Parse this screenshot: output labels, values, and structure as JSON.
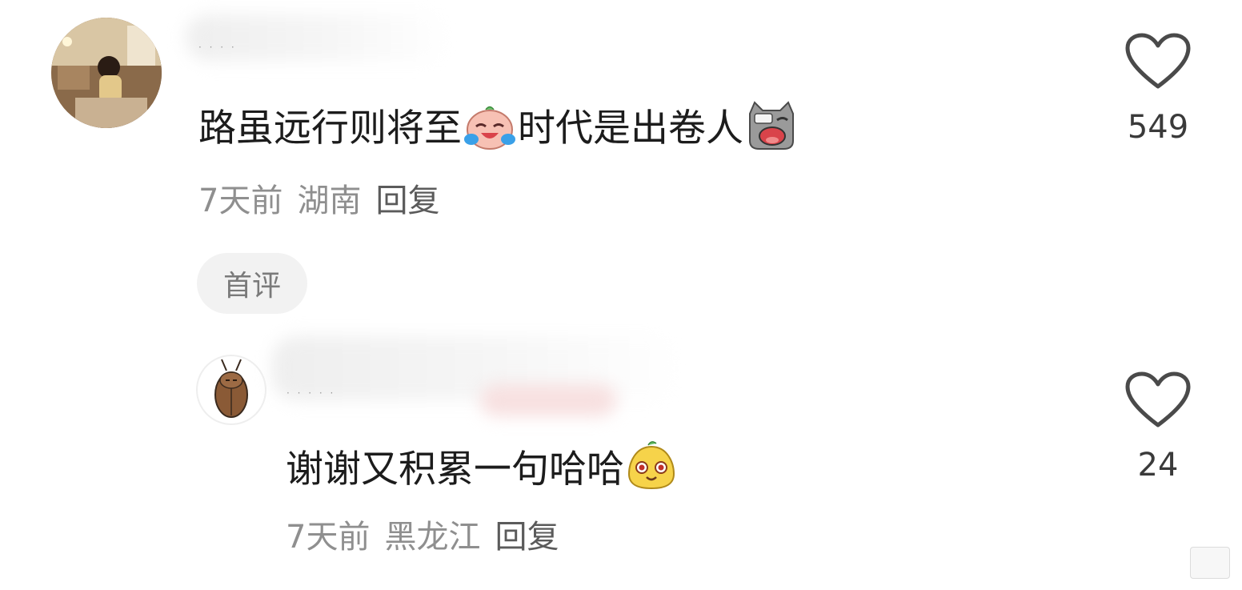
{
  "comments": [
    {
      "username": "· ·   · ·",
      "text_before": "路虽远行则将至",
      "text_middle": "时代是出卷人",
      "emoji_1": "crying-laughing-face-icon",
      "emoji_2": "crying-cat-icon",
      "time": "7天前",
      "location": "湖南",
      "reply_label": "回复",
      "badge": "首评",
      "likes": "549"
    },
    {
      "username": "· · ·   · ·",
      "text": "谢谢又积累一句哈哈",
      "emoji": "smiling-yellow-face-icon",
      "time": "7天前",
      "location": "黑龙江",
      "reply_label": "回复",
      "likes": "24"
    }
  ],
  "colors": {
    "text": "#1c1c1c",
    "meta": "#8f8f8f",
    "badge_bg": "#f2f2f2",
    "heart_stroke": "#4a4a4a"
  }
}
